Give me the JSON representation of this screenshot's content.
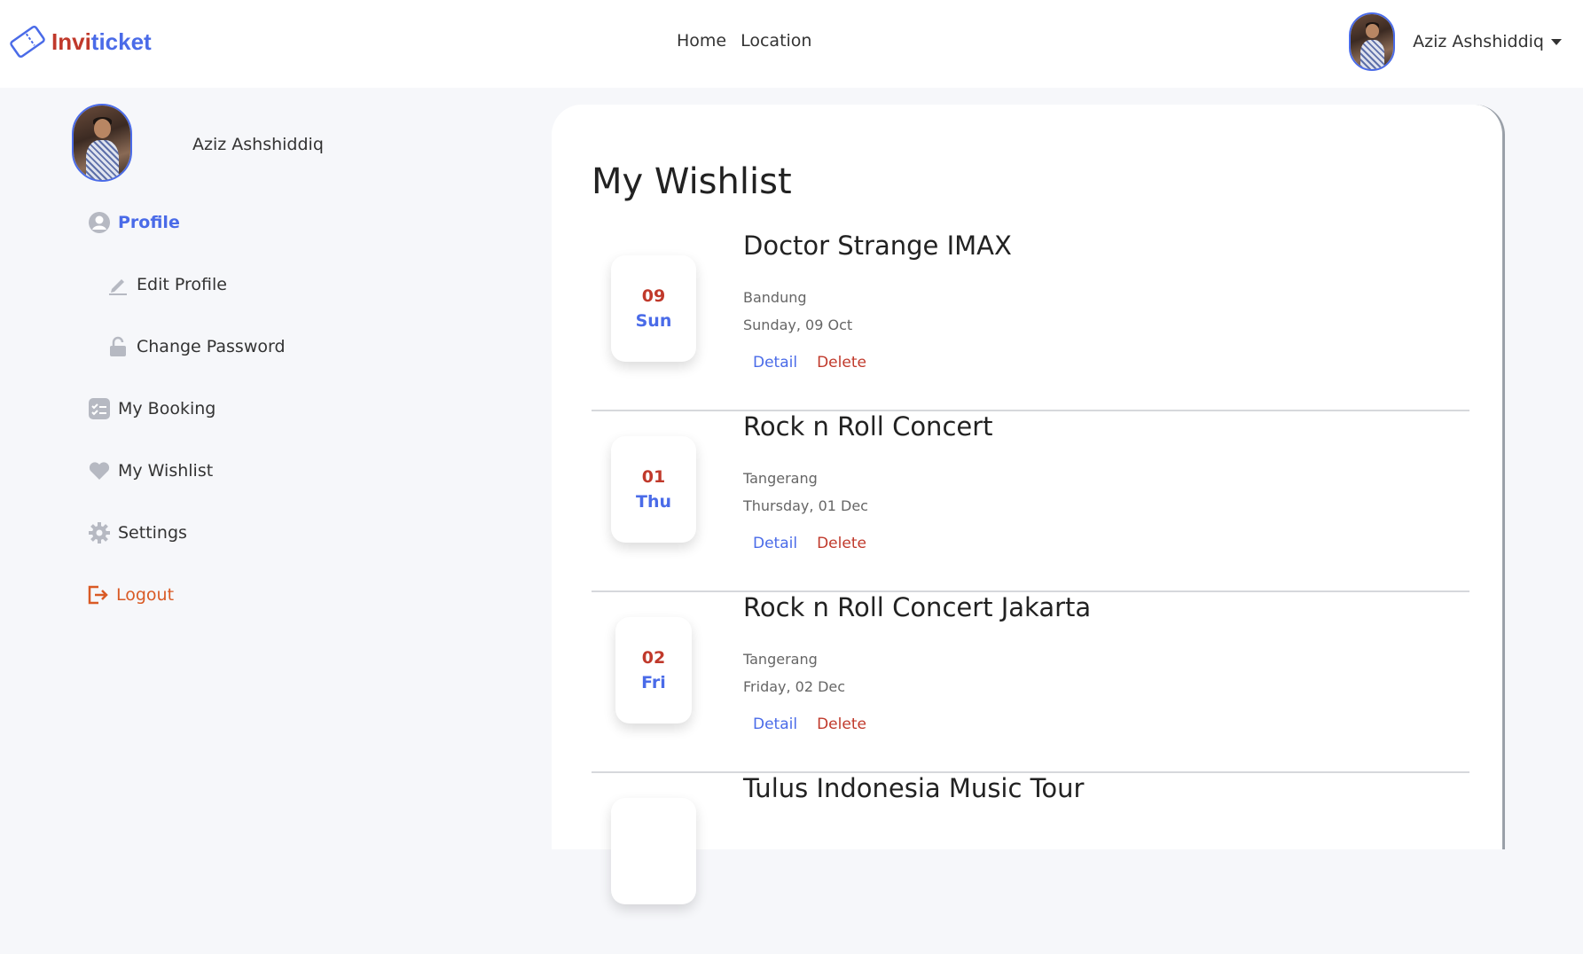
{
  "brand": {
    "part1": "Invi",
    "part2": "ticket"
  },
  "nav": {
    "home": "Home",
    "location": "Location"
  },
  "user": {
    "name": "Aziz Ashshiddiq"
  },
  "sidebar": {
    "name": "Aziz Ashshiddiq",
    "items": [
      {
        "label": "Profile",
        "icon": "user-circle-icon"
      },
      {
        "label": "Edit Profile",
        "icon": "pencil-icon"
      },
      {
        "label": "Change Password",
        "icon": "unlock-icon"
      },
      {
        "label": "My Booking",
        "icon": "checklist-icon"
      },
      {
        "label": "My Wishlist",
        "icon": "heart-icon"
      },
      {
        "label": "Settings",
        "icon": "gear-icon"
      },
      {
        "label": "Logout",
        "icon": "logout-icon"
      }
    ]
  },
  "main": {
    "title": "My Wishlist",
    "items": [
      {
        "num": "09",
        "day": "Sun",
        "title": "Doctor Strange IMAX",
        "location": "Bandung",
        "date": "Sunday, 09 Oct",
        "detail": "Detail",
        "delete": "Delete"
      },
      {
        "num": "01",
        "day": "Thu",
        "title": "Rock n Roll Concert",
        "location": "Tangerang",
        "date": "Thursday, 01 Dec",
        "detail": "Detail",
        "delete": "Delete"
      },
      {
        "num": "02",
        "day": "Fri",
        "title": "Rock n Roll Concert Jakarta",
        "location": "Tangerang",
        "date": "Friday, 02 Dec",
        "detail": "Detail",
        "delete": "Delete"
      },
      {
        "title": "Tulus Indonesia Music Tour"
      }
    ]
  },
  "colors": {
    "accent": "#4a6be8",
    "danger": "#c0392b",
    "logout": "#d95a25"
  }
}
